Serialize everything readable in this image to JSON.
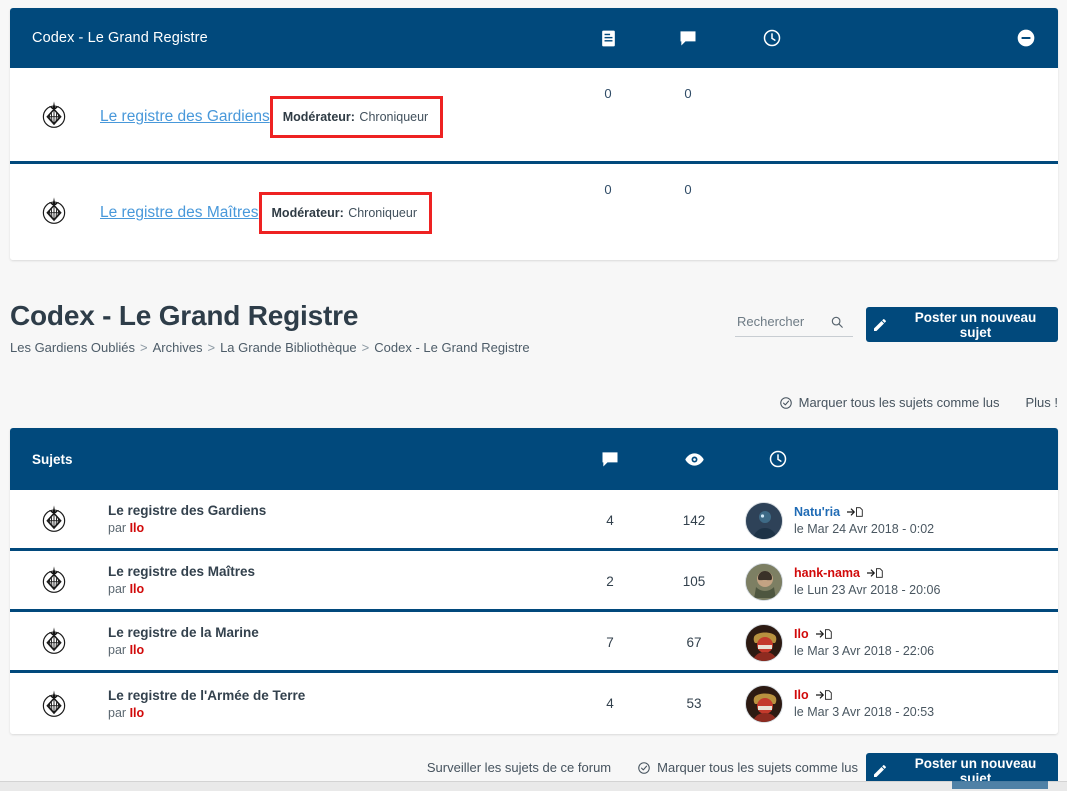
{
  "forum_block": {
    "header": {
      "title": "Codex - Le Grand Registre",
      "icons": [
        "topics-icon",
        "posts-icon",
        "clock-icon"
      ],
      "collapse_icon": "minus-circle-icon"
    },
    "rows": [
      {
        "icon": "forum-emblem-icon",
        "name": "Le registre des Gardiens",
        "moderator_label": "Modérateur:",
        "moderator_value": "Chroniqueur",
        "topics": "0",
        "posts": "0"
      },
      {
        "icon": "forum-emblem-icon",
        "name": "Le registre des Maîtres",
        "moderator_label": "Modérateur:",
        "moderator_value": "Chroniqueur",
        "topics": "0",
        "posts": "0"
      }
    ]
  },
  "page": {
    "title": "Codex - Le Grand Registre",
    "breadcrumb": [
      "Les Gardiens Oubliés",
      "Archives",
      "La Grande Bibliothèque",
      "Codex - Le Grand Registre"
    ],
    "breadcrumb_separator": ">"
  },
  "search": {
    "placeholder": "Rechercher",
    "value": "",
    "icon": "search-icon"
  },
  "post_button": {
    "label": "Poster un nouveau sujet",
    "icon": "pencil-icon"
  },
  "actions_top": {
    "mark_read": "Marquer tous les sujets comme lus",
    "mark_read_icon": "check-circle-icon",
    "more": "Plus !"
  },
  "topics_table": {
    "header": {
      "title": "Sujets",
      "icons": [
        "replies-icon",
        "views-icon",
        "clock-icon"
      ]
    },
    "rows": [
      {
        "icon": "forum-emblem-icon",
        "title": "Le registre des Gardiens",
        "by_label": "par",
        "author": "Ilo",
        "replies": "4",
        "views": "142",
        "last_post": {
          "avatar": "avatar-natu-ria",
          "user": "Natu'ria",
          "user_color": "blue",
          "goto_icon": "goto-last-post-icon",
          "date": "le Mar 24 Avr 2018 - 0:02"
        }
      },
      {
        "icon": "forum-emblem-icon",
        "title": "Le registre des Maîtres",
        "by_label": "par",
        "author": "Ilo",
        "replies": "2",
        "views": "105",
        "last_post": {
          "avatar": "avatar-hank-nama",
          "user": "hank-nama",
          "user_color": "red",
          "goto_icon": "goto-last-post-icon",
          "date": "le Lun 23 Avr 2018 - 20:06"
        }
      },
      {
        "icon": "forum-emblem-icon",
        "title": "Le registre de la Marine",
        "by_label": "par",
        "author": "Ilo",
        "replies": "7",
        "views": "67",
        "last_post": {
          "avatar": "avatar-ilo",
          "user": "Ilo",
          "user_color": "red",
          "goto_icon": "goto-last-post-icon",
          "date": "le Mar 3 Avr 2018 - 22:06"
        }
      },
      {
        "icon": "forum-emblem-icon",
        "title": "Le registre de l'Armée de Terre",
        "by_label": "par",
        "author": "Ilo",
        "replies": "4",
        "views": "53",
        "last_post": {
          "avatar": "avatar-ilo",
          "user": "Ilo",
          "user_color": "red",
          "goto_icon": "goto-last-post-icon",
          "date": "le Mar 3 Avr 2018 - 20:53"
        }
      }
    ]
  },
  "actions_bottom": {
    "watch": "Surveiller les sujets de ce forum",
    "mark_read": "Marquer tous les sujets comme lus",
    "mark_read_icon": "check-circle-icon"
  },
  "colors": {
    "header_blue": "#01497c",
    "link_blue": "#4898da",
    "author_red": "#d10a0a",
    "annotation_red": "#ee2222",
    "page_bg": "#f7f7f7"
  }
}
